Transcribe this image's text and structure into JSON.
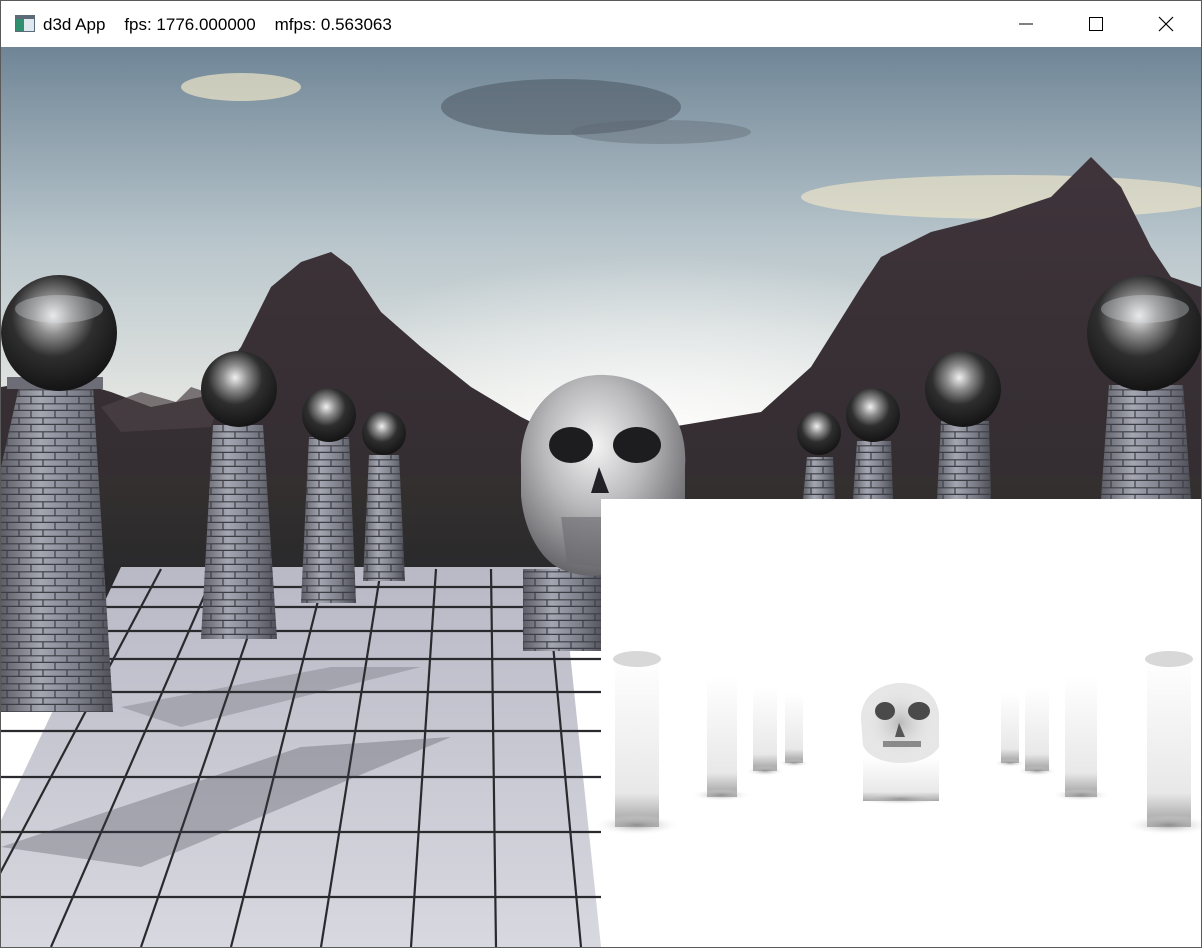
{
  "window": {
    "title": "d3d App",
    "fps_text": "fps: 1776.000000",
    "mfps_text": "mfps: 0.563063"
  },
  "caption_buttons": [
    {
      "name": "minimize",
      "icon": "minimize-icon"
    },
    {
      "name": "maximize",
      "icon": "maximize-icon"
    },
    {
      "name": "close",
      "icon": "close-icon"
    }
  ],
  "scene": {
    "description_icons": [
      "skull-model",
      "chrome-sphere",
      "stone-pillar",
      "tiled-floor",
      "mountain",
      "sky"
    ],
    "colors": {
      "sky_top": "#6d8494",
      "sky_horizon": "#f6f3e8",
      "mountain": "#3a3036",
      "floor": "#c9c9d3",
      "floor_grout": "#2a2a2e",
      "ssao_background": "#ffffff"
    }
  }
}
